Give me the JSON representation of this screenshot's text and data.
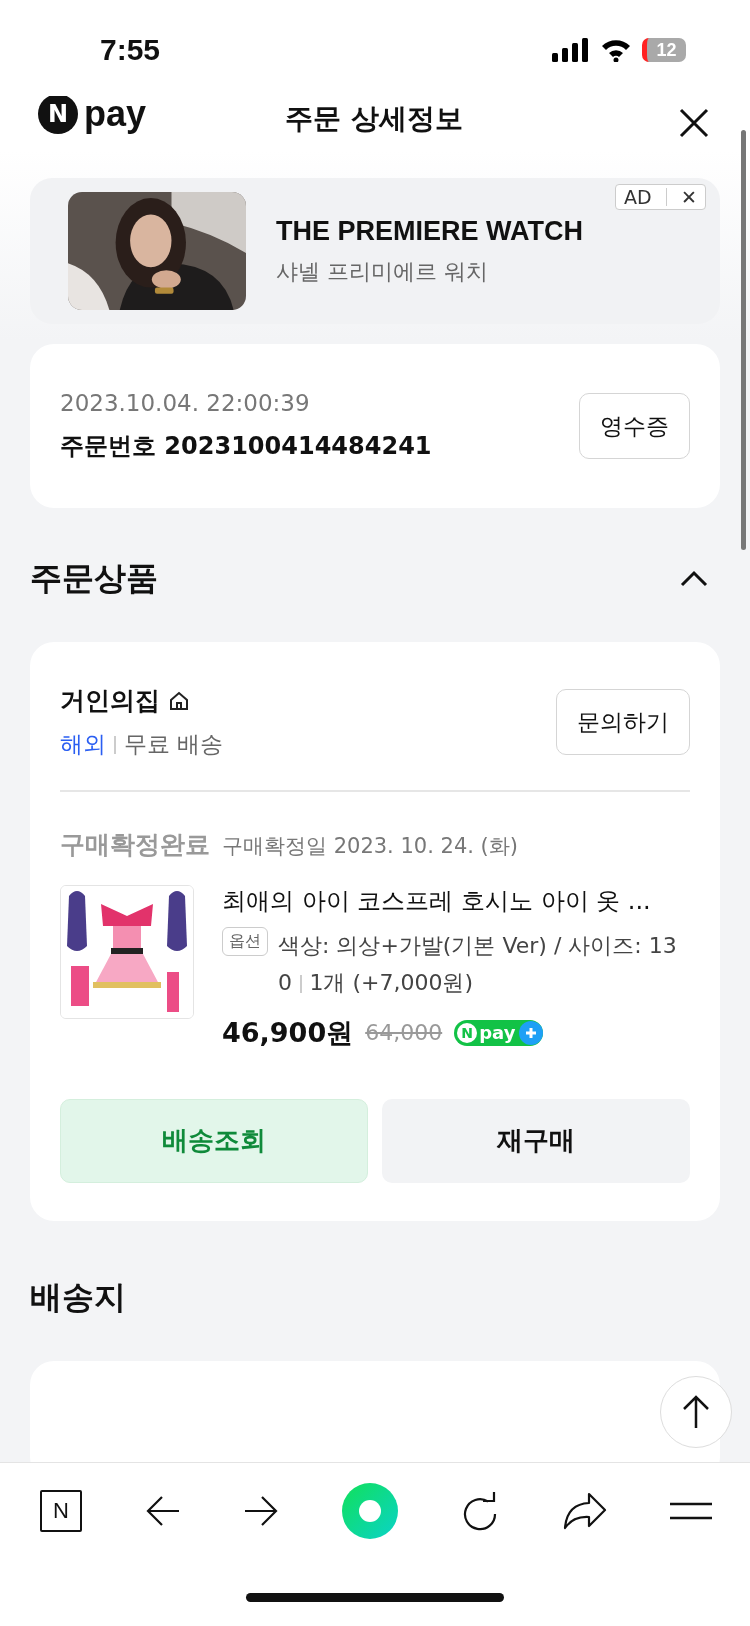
{
  "status_bar": {
    "time": "7:55",
    "battery": "12"
  },
  "header": {
    "logo_mark": "N",
    "logo_text": "pay",
    "title": "주문 상세정보"
  },
  "ad": {
    "kind": "picture",
    "badge": "AD",
    "close": "✕",
    "title": "THE PREMIERE WATCH",
    "subtitle": "샤넬 프리미에르 워치"
  },
  "order": {
    "datetime": "2023.10.04. 22:00:39",
    "number": "주문번호 2023100414484241",
    "receipt_button": "영수증"
  },
  "products_section": {
    "title": "주문상품",
    "expanded": true,
    "seller": {
      "name": "거인의집",
      "origin": "해외",
      "shipping": "무료 배송",
      "inquiry_button": "문의하기"
    },
    "item": {
      "status": "구매확정완료",
      "confirm_date": "구매확정일 2023. 10. 24. (화)",
      "name": "최애의 아이 코스프레 호시노 아이 옷 ...",
      "option_tag": "옵션",
      "option": "색상: 의상+가발(기본 Ver) / 사이즈: 130",
      "quantity": "1개 (+7,000원)",
      "price": "46,900원",
      "original_price": "64,000",
      "npay_mark": "N",
      "npay_text": "pay"
    },
    "buttons": [
      {
        "label": "배송조회",
        "kind": "primary"
      },
      {
        "label": "재구매",
        "kind": "secondary"
      }
    ]
  },
  "shipping_section": {
    "title": "배송지"
  },
  "toolbar": {
    "home_mark": "N"
  }
}
